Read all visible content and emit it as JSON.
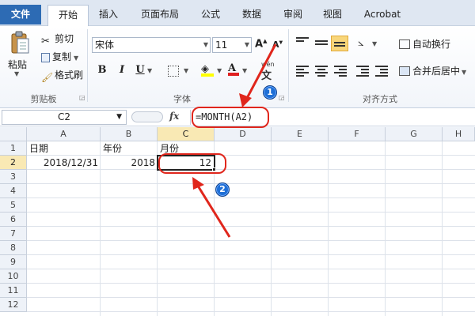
{
  "tabs": [
    {
      "label": "文件"
    },
    {
      "label": "开始"
    },
    {
      "label": "插入"
    },
    {
      "label": "页面布局"
    },
    {
      "label": "公式"
    },
    {
      "label": "数据"
    },
    {
      "label": "审阅"
    },
    {
      "label": "视图"
    },
    {
      "label": "Acrobat"
    }
  ],
  "clipboard": {
    "paste": "粘贴",
    "cut": "剪切",
    "copy": "复制",
    "format_painter": "格式刷",
    "group_label": "剪贴板"
  },
  "font": {
    "name": "宋体",
    "size": "11",
    "bold": "B",
    "italic": "I",
    "underline": "U",
    "group_label": "字体",
    "phonetic": "wén"
  },
  "alignment": {
    "wrap": "自动换行",
    "merge": "合并后居中",
    "group_label": "对齐方式"
  },
  "formula_bar": {
    "name_box": "C2",
    "fx": "fx",
    "formula": "=MONTH(A2)"
  },
  "sheet": {
    "columns": [
      "A",
      "B",
      "C",
      "D",
      "E",
      "F",
      "G",
      "H"
    ],
    "rows": [
      "1",
      "2",
      "3",
      "4",
      "5",
      "6",
      "7",
      "8",
      "9",
      "10",
      "11",
      "12"
    ],
    "cells": {
      "A1": "日期",
      "B1": "年份",
      "C1": "月份",
      "A2": "2018/12/31",
      "B2": "2018",
      "C2": "12"
    },
    "active_cell": "C2"
  },
  "annotations": {
    "badge_1": "1",
    "badge_2": "2",
    "color": "#e0261c"
  }
}
